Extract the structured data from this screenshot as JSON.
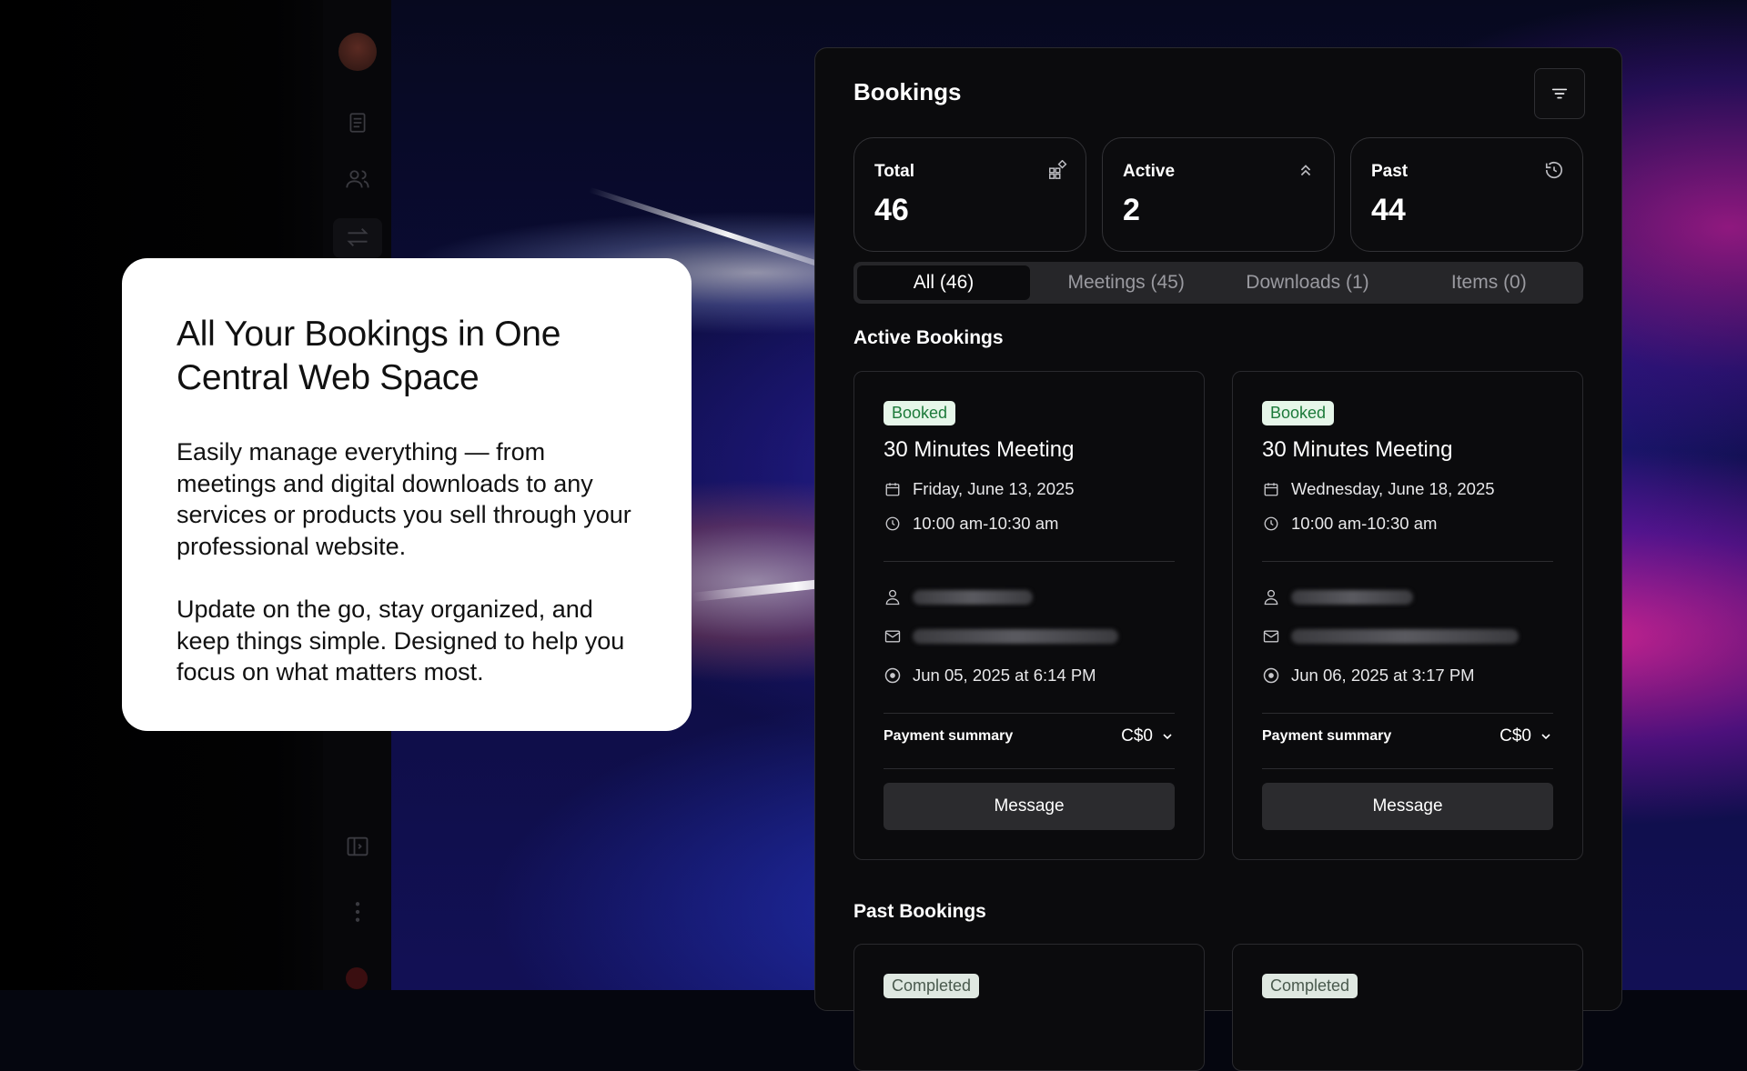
{
  "promo": {
    "headline": "All Your Bookings in One Central Web Space",
    "paragraph1": "Easily manage everything — from meetings and digital downloads to any services or products you sell through your professional website.",
    "paragraph2": "Update on the go, stay organized, and keep things simple. Designed to help you focus on what matters most."
  },
  "panel": {
    "title": "Bookings",
    "stats": [
      {
        "label": "Total",
        "value": "46",
        "icon": "grid-plus-icon"
      },
      {
        "label": "Active",
        "value": "2",
        "icon": "chevrons-up-icon"
      },
      {
        "label": "Past",
        "value": "44",
        "icon": "history-icon"
      }
    ],
    "tabs": [
      {
        "label": "All (46)",
        "active": true
      },
      {
        "label": "Meetings (45)",
        "active": false
      },
      {
        "label": "Downloads (1)",
        "active": false
      },
      {
        "label": "Items (0)",
        "active": false
      }
    ],
    "active_section": "Active Bookings",
    "past_section": "Past Bookings",
    "active_bookings": [
      {
        "status": "Booked",
        "title": "30 Minutes Meeting",
        "date": "Friday, June 13, 2025",
        "time": "10:00 am-10:30 am",
        "booked_at": "Jun 05, 2025 at 6:14 PM",
        "payment_label": "Payment summary",
        "payment_value": "C$0",
        "button": "Message"
      },
      {
        "status": "Booked",
        "title": "30 Minutes Meeting",
        "date": "Wednesday, June 18, 2025",
        "time": "10:00 am-10:30 am",
        "booked_at": "Jun 06, 2025 at 3:17 PM",
        "payment_label": "Payment summary",
        "payment_value": "C$0",
        "button": "Message"
      }
    ],
    "past_bookings": [
      {
        "status": "Completed"
      },
      {
        "status": "Completed"
      }
    ]
  },
  "colors": {
    "booked_badge_bg": "#e6f6e9",
    "booked_badge_text": "#1c7a3a",
    "panel_bg": "#0b0b0d"
  }
}
